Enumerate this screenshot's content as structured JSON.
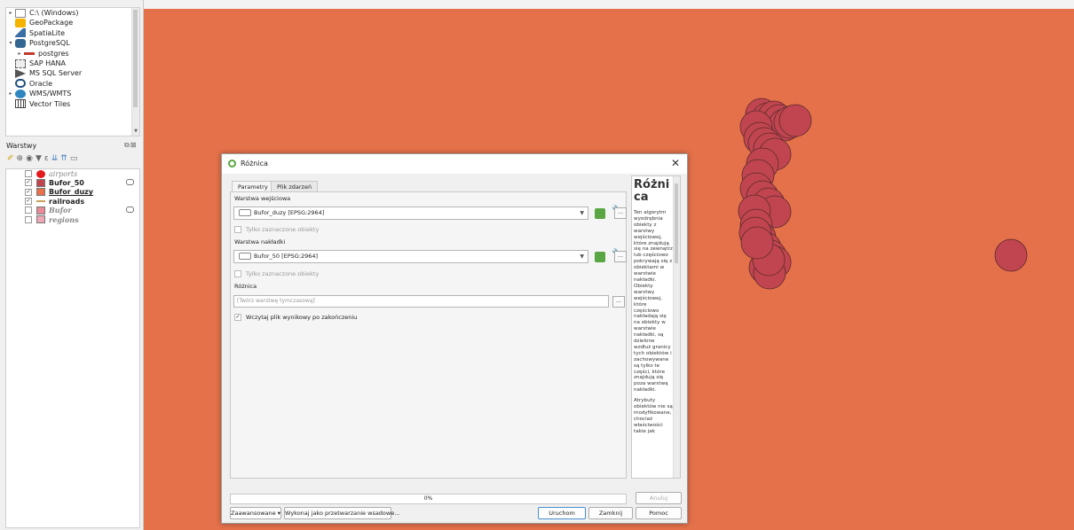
{
  "browser": {
    "items": [
      {
        "label": "C:\\ (Windows)",
        "arrow": "▸",
        "icon": "folder-icon",
        "indent": 0
      },
      {
        "label": "GeoPackage",
        "arrow": "",
        "icon": "geopackage-icon",
        "indent": 0
      },
      {
        "label": "SpatiaLite",
        "arrow": "",
        "icon": "spatialite-icon",
        "indent": 0
      },
      {
        "label": "PostgreSQL",
        "arrow": "▾",
        "icon": "postgresql-icon",
        "indent": 0
      },
      {
        "label": "postgres",
        "arrow": "▸",
        "icon": "connection-icon",
        "indent": 1
      },
      {
        "label": "SAP HANA",
        "arrow": "",
        "icon": "sap-hana-icon",
        "indent": 0
      },
      {
        "label": "MS SQL Server",
        "arrow": "",
        "icon": "mssql-icon",
        "indent": 0
      },
      {
        "label": "Oracle",
        "arrow": "",
        "icon": "oracle-icon",
        "indent": 0
      },
      {
        "label": "WMS/WMTS",
        "arrow": "▸",
        "icon": "wms-icon",
        "indent": 0
      },
      {
        "label": "Vector Tiles",
        "arrow": "",
        "icon": "vector-tiles-icon",
        "indent": 0
      }
    ]
  },
  "layers": {
    "title": "Warstwy",
    "items": [
      {
        "name": "airports",
        "checked": false,
        "symbol": "point",
        "color": "#e31a1c",
        "italic": true,
        "bold": false,
        "underline": false,
        "muted": false,
        "filter": false
      },
      {
        "name": "Bufor_50",
        "checked": true,
        "symbol": "fill",
        "color": "#c04550",
        "italic": false,
        "bold": true,
        "underline": false,
        "muted": false,
        "filter": true
      },
      {
        "name": "Bufor_duzy",
        "checked": true,
        "symbol": "fill",
        "color": "#e8704a",
        "italic": false,
        "bold": true,
        "underline": true,
        "muted": false,
        "filter": false
      },
      {
        "name": "railroads",
        "checked": true,
        "symbol": "line",
        "color": "#c9a15a",
        "italic": false,
        "bold": true,
        "underline": false,
        "muted": false,
        "filter": false
      },
      {
        "name": "Bufor",
        "checked": false,
        "symbol": "fill",
        "color": "#e88a98",
        "italic": true,
        "bold": true,
        "underline": false,
        "muted": true,
        "filter": true
      },
      {
        "name": "regions",
        "checked": false,
        "symbol": "fill",
        "color": "#f0a8b4",
        "italic": true,
        "bold": true,
        "underline": false,
        "muted": true,
        "filter": false
      }
    ]
  },
  "map": {
    "background": "#e5714a",
    "feature_fill": "#c04550",
    "feature_stroke": "#5a2a2a"
  },
  "dialog": {
    "title": "Różnica",
    "close_glyph": "✕",
    "tabs": {
      "params": "Parametry",
      "log": "Plik zdarzeń"
    },
    "input_label": "Warstwa wejściowa",
    "input_value": "Bufor_duzy [EPSG:2964]",
    "input_selected_only": "Tylko zaznaczone obiekty",
    "overlay_label": "Warstwa nakładki",
    "overlay_value": "Bufor_50 [EPSG:2964]",
    "overlay_selected_only": "Tylko zaznaczone obiekty",
    "output_label": "Różnica",
    "output_placeholder": "[Twórz warstwę tymczasową]",
    "open_output": "Wczytaj plik wynikowy po zakończeniu",
    "progress_text": "0%",
    "progress": 0,
    "buttons": {
      "cancel": "Anuluj",
      "advanced": "Zaawansowane ▾",
      "batch": "Wykonaj jako przetwarzanie wsadowe...",
      "run": "Uruchom",
      "close": "Zamknij",
      "help": "Pomoc"
    },
    "help": {
      "title": "Różnica",
      "paragraphs": [
        "Ten algorytm wyodrębnia obiekty z warstwy wejściowej, które znajdują się na zewnątrz lub częściowo pokrywają się z obiektami w warstwie nakładki. Obiekty warstwy wejściowej, które częściowo nakładają się na obiekty w warstwie nakładki, są dzielone wzdłuż granicy tych obiektów i zachowywane są tylko te części, które znajdują się poza warstwą nakładki.",
        "Atrybuty obiektów nie są modyfikowane, chociaż właściwości takie jak"
      ]
    }
  }
}
